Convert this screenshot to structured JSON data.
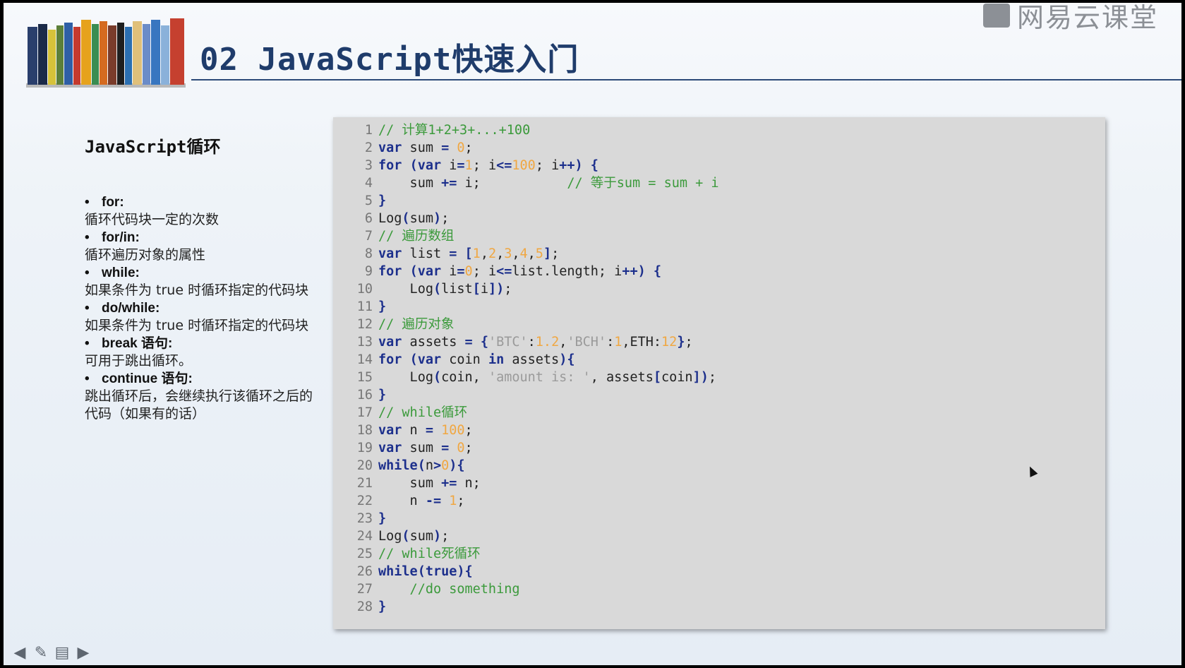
{
  "header": {
    "title": "02 JavaScript快速入门",
    "watermark": "网易云课堂"
  },
  "left_panel": {
    "section_title": "JavaScript循环",
    "items": [
      {
        "head": "for:",
        "desc": "循环代码块一定的次数"
      },
      {
        "head": "for/in:",
        "desc": "循环遍历对象的属性"
      },
      {
        "head": "while:",
        "desc": "如果条件为 true 时循环指定的代码块"
      },
      {
        "head": "do/while:",
        "desc": "如果条件为 true 时循环指定的代码块"
      },
      {
        "head": "break 语句:",
        "desc": "可用于跳出循环。"
      },
      {
        "head": "continue 语句:",
        "desc": "跳出循环后，会继续执行该循环之后的代码（如果有的话）"
      }
    ]
  },
  "code": {
    "lines": [
      [
        [
          "cm",
          "// 计算1+2+3+...+100"
        ]
      ],
      [
        [
          "kw",
          "var"
        ],
        [
          "pl",
          " sum "
        ],
        [
          "op",
          "="
        ],
        [
          "pl",
          " "
        ],
        [
          "num",
          "0"
        ],
        [
          "pl",
          ";"
        ]
      ],
      [
        [
          "kw",
          "for"
        ],
        [
          "pl",
          " "
        ],
        [
          "op",
          "("
        ],
        [
          "kw",
          "var"
        ],
        [
          "pl",
          " i"
        ],
        [
          "op",
          "="
        ],
        [
          "num",
          "1"
        ],
        [
          "pl",
          "; i"
        ],
        [
          "op",
          "<="
        ],
        [
          "num",
          "100"
        ],
        [
          "pl",
          "; i"
        ],
        [
          "op",
          "++"
        ],
        [
          "op",
          ")"
        ],
        [
          "pl",
          " "
        ],
        [
          "op",
          "{"
        ]
      ],
      [
        [
          "pl",
          "    sum "
        ],
        [
          "op",
          "+="
        ],
        [
          "pl",
          " i;           "
        ],
        [
          "cm",
          "// 等于sum = sum + i"
        ]
      ],
      [
        [
          "op",
          "}"
        ]
      ],
      [
        [
          "pl",
          "Log"
        ],
        [
          "op",
          "("
        ],
        [
          "pl",
          "sum"
        ],
        [
          "op",
          ")"
        ],
        [
          "pl",
          ";"
        ]
      ],
      [
        [
          "cm",
          "// 遍历数组"
        ]
      ],
      [
        [
          "kw",
          "var"
        ],
        [
          "pl",
          " list "
        ],
        [
          "op",
          "="
        ],
        [
          "pl",
          " "
        ],
        [
          "op",
          "["
        ],
        [
          "num",
          "1"
        ],
        [
          "pl",
          ","
        ],
        [
          "num",
          "2"
        ],
        [
          "pl",
          ","
        ],
        [
          "num",
          "3"
        ],
        [
          "pl",
          ","
        ],
        [
          "num",
          "4"
        ],
        [
          "pl",
          ","
        ],
        [
          "num",
          "5"
        ],
        [
          "op",
          "]"
        ],
        [
          "pl",
          ";"
        ]
      ],
      [
        [
          "kw",
          "for"
        ],
        [
          "pl",
          " "
        ],
        [
          "op",
          "("
        ],
        [
          "kw",
          "var"
        ],
        [
          "pl",
          " i"
        ],
        [
          "op",
          "="
        ],
        [
          "num",
          "0"
        ],
        [
          "pl",
          "; i"
        ],
        [
          "op",
          "<="
        ],
        [
          "pl",
          "list.length; i"
        ],
        [
          "op",
          "++"
        ],
        [
          "op",
          ")"
        ],
        [
          "pl",
          " "
        ],
        [
          "op",
          "{"
        ]
      ],
      [
        [
          "pl",
          "    Log"
        ],
        [
          "op",
          "("
        ],
        [
          "pl",
          "list"
        ],
        [
          "op",
          "["
        ],
        [
          "pl",
          "i"
        ],
        [
          "op",
          "]"
        ],
        [
          "op",
          ")"
        ],
        [
          "pl",
          ";"
        ]
      ],
      [
        [
          "op",
          "}"
        ]
      ],
      [
        [
          "cm",
          "// 遍历对象"
        ]
      ],
      [
        [
          "kw",
          "var"
        ],
        [
          "pl",
          " assets "
        ],
        [
          "op",
          "="
        ],
        [
          "pl",
          " "
        ],
        [
          "op",
          "{"
        ],
        [
          "str",
          "'BTC'"
        ],
        [
          "pl",
          ":"
        ],
        [
          "num",
          "1.2"
        ],
        [
          "pl",
          ","
        ],
        [
          "str",
          "'BCH'"
        ],
        [
          "pl",
          ":"
        ],
        [
          "num",
          "1"
        ],
        [
          "pl",
          ",ETH:"
        ],
        [
          "num",
          "12"
        ],
        [
          "op",
          "}"
        ],
        [
          "pl",
          ";"
        ]
      ],
      [
        [
          "kw",
          "for"
        ],
        [
          "pl",
          " "
        ],
        [
          "op",
          "("
        ],
        [
          "kw",
          "var"
        ],
        [
          "pl",
          " coin "
        ],
        [
          "kw",
          "in"
        ],
        [
          "pl",
          " assets"
        ],
        [
          "op",
          ")"
        ],
        [
          "op",
          "{"
        ]
      ],
      [
        [
          "pl",
          "    Log"
        ],
        [
          "op",
          "("
        ],
        [
          "pl",
          "coin, "
        ],
        [
          "str",
          "'amount is: '"
        ],
        [
          "pl",
          ", assets"
        ],
        [
          "op",
          "["
        ],
        [
          "pl",
          "coin"
        ],
        [
          "op",
          "]"
        ],
        [
          "op",
          ")"
        ],
        [
          "pl",
          ";"
        ]
      ],
      [
        [
          "op",
          "}"
        ]
      ],
      [
        [
          "cm",
          "// while循环"
        ]
      ],
      [
        [
          "kw",
          "var"
        ],
        [
          "pl",
          " n "
        ],
        [
          "op",
          "="
        ],
        [
          "pl",
          " "
        ],
        [
          "num",
          "100"
        ],
        [
          "pl",
          ";"
        ]
      ],
      [
        [
          "kw",
          "var"
        ],
        [
          "pl",
          " sum "
        ],
        [
          "op",
          "="
        ],
        [
          "pl",
          " "
        ],
        [
          "num",
          "0"
        ],
        [
          "pl",
          ";"
        ]
      ],
      [
        [
          "kw",
          "while"
        ],
        [
          "op",
          "("
        ],
        [
          "pl",
          "n"
        ],
        [
          "op",
          ">"
        ],
        [
          "num",
          "0"
        ],
        [
          "op",
          ")"
        ],
        [
          "op",
          "{"
        ]
      ],
      [
        [
          "pl",
          "    sum "
        ],
        [
          "op",
          "+="
        ],
        [
          "pl",
          " n;"
        ]
      ],
      [
        [
          "pl",
          "    n "
        ],
        [
          "op",
          "-="
        ],
        [
          "pl",
          " "
        ],
        [
          "num",
          "1"
        ],
        [
          "pl",
          ";"
        ]
      ],
      [
        [
          "op",
          "}"
        ]
      ],
      [
        [
          "pl",
          "Log"
        ],
        [
          "op",
          "("
        ],
        [
          "pl",
          "sum"
        ],
        [
          "op",
          ")"
        ],
        [
          "pl",
          ";"
        ]
      ],
      [
        [
          "cm",
          "// while死循环"
        ]
      ],
      [
        [
          "kw",
          "while"
        ],
        [
          "op",
          "("
        ],
        [
          "kw",
          "true"
        ],
        [
          "op",
          ")"
        ],
        [
          "op",
          "{"
        ]
      ],
      [
        [
          "cm",
          "    //do something"
        ]
      ],
      [
        [
          "op",
          "}"
        ]
      ]
    ]
  },
  "nav": {
    "icons": [
      "arrow-left-icon",
      "pen-icon",
      "menu-icon",
      "arrow-right-icon"
    ]
  }
}
